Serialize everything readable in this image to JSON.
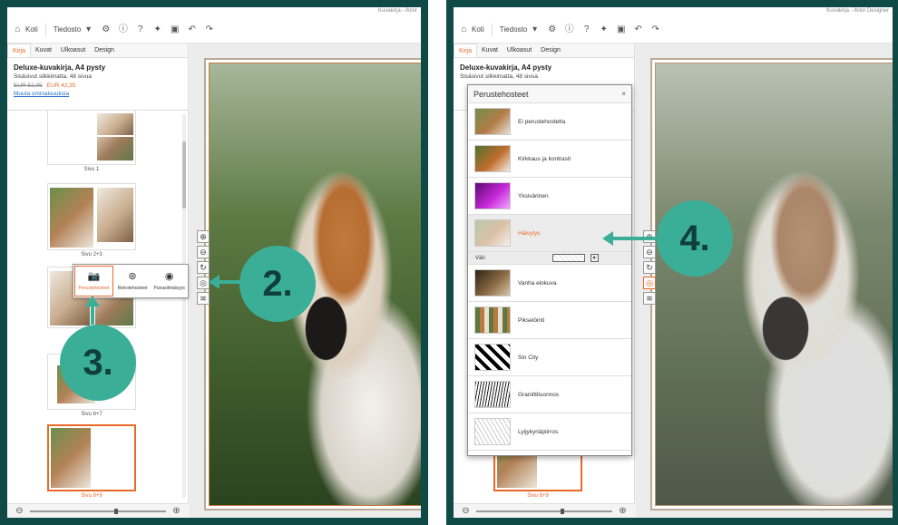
{
  "app": {
    "title_left": "Kuvakirja - ifolor",
    "title_right": "Kuvakirja - ifolor Designer"
  },
  "toolbar": {
    "home_label": "Koti",
    "file_label": "Tiedosto"
  },
  "tabs": [
    "Kirja",
    "Kuvat",
    "Ulkoasut",
    "Design"
  ],
  "product": {
    "title": "Deluxe-kuvakirja, A4 pysty",
    "subtitle": "Sisäsivut silkkimatta, 48 sivua",
    "old_price": "EUR 52,95",
    "new_price": "EUR 42,35",
    "link": "Muuta ominaisuuksia"
  },
  "pages_left": [
    "Sivu 1",
    "Sivu 2+3",
    "Sivu 6+7",
    "Sivu 8+9"
  ],
  "pages_right": [
    "Sivu 8+9"
  ],
  "popup": {
    "items": [
      "Perustehosteet",
      "Retrotehosteet",
      "Punasilmäisyys"
    ],
    "active_index": 0
  },
  "callouts": {
    "two": "2.",
    "three": "3.",
    "four": "4."
  },
  "effects_panel": {
    "title": "Perustehosteet",
    "close": "×",
    "items": [
      {
        "label": "Ei perustehostetta"
      },
      {
        "label": "Kirkkaus ja kontrasti"
      },
      {
        "label": "Yksivärinen"
      },
      {
        "label": "Häivytys",
        "active": true
      },
      {
        "label": "Vanha elokuva"
      },
      {
        "label": "Pikselöinti"
      },
      {
        "label": "Sin City"
      },
      {
        "label": "Graniittiluonnos"
      },
      {
        "label": "Lyijykynäpiirros"
      }
    ],
    "color_label": "Väri"
  },
  "colors": {
    "brand": "#0f4a47",
    "accent": "#e8692b",
    "callout": "#3bae97",
    "callout_text": "#0f3f3a"
  }
}
